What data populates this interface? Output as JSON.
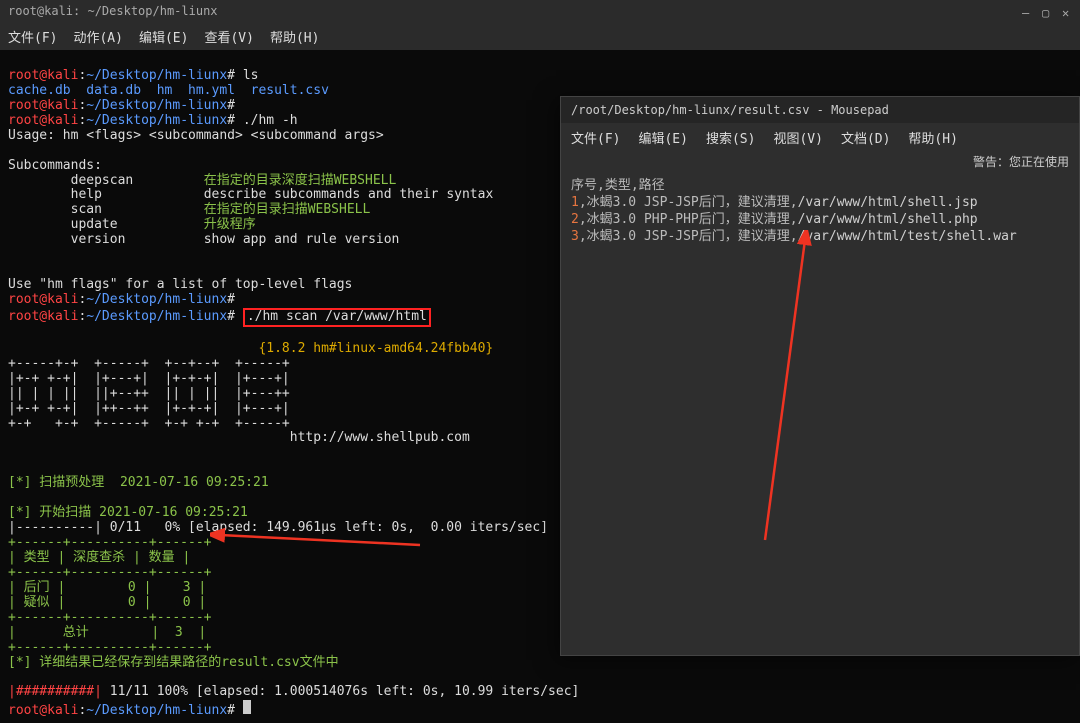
{
  "titlebar": {
    "title": "root@kali: ~/Desktop/hm-liunx"
  },
  "menubar": {
    "items": [
      "文件(F)",
      "动作(A)",
      "编辑(E)",
      "查看(V)",
      "帮助(H)"
    ]
  },
  "prompt": {
    "user": "root@kali",
    "sep": ":",
    "path": "~/Desktop/hm-liunx",
    "sigil": "#"
  },
  "cmd": {
    "ls": "ls",
    "ls_out": "cache.db  data.db  hm  hm.yml  result.csv",
    "hm_h": "./hm -h",
    "usage": "Usage: hm <flags> <subcommand> <subcommand args>",
    "sub_header": "Subcommands:",
    "deepscan": "deepscan",
    "deepscan_desc": "在指定的目录深度扫描WEBSHELL",
    "help": "help",
    "help_desc": "describe subcommands and their syntax",
    "scan": "scan",
    "scan_desc": "在指定的目录扫描WEBSHELL",
    "update": "update",
    "update_desc": "升级程序",
    "version": "version",
    "version_desc": "show app and rule version",
    "flags_hint": "Use \"hm flags\" for a list of top-level flags",
    "scan_cmd": "./hm scan /var/www/html",
    "ver_line": "{1.8.2 hm#linux-amd64.24fbb40}",
    "ascii1": "+-----+-+  +-----+  +--+--+  +-----+",
    "ascii2": "|+-+ +-+|  |+---+|  |+-+-+|  |+---+|",
    "ascii3": "|| | | ||  ||+--++  || | ||  |+---++",
    "ascii4": "|+-+ +-+|  |++--++  |+-+-+|  |+---+|",
    "ascii5": "+-+   +-+  +-----+  +-+ +-+  +-----+",
    "url": "http://www.shellpub.com",
    "pre_scan": "[*] 扫描预处理  2021-07-16 09:25:21",
    "start_scan": "[*] 开始扫描 2021-07-16 09:25:21",
    "bar0": "|----------| 0/11   0% [elapsed: 149.961µs left: 0s,  0.00 iters/sec]",
    "divider": "+------+----------+------+",
    "th": "| 类型 | 深度查杀 | 数量 |",
    "r1": "| 后门 |        0 |    3 |",
    "r2": "| 疑似 |        0 |    0 |",
    "rt": "|      总计        |  3  |",
    "saved": "[*] 详细结果已经保存到结果路径的result.csv文件中",
    "bar_full": "|##########|",
    "bar1": " 11/11 100% [elapsed: 1.000514076s left: 0s, 10.99 iters/sec]"
  },
  "mousepad": {
    "title": "/root/Desktop/hm-liunx/result.csv - Mousepad",
    "menu": [
      "文件(F)",
      "编辑(E)",
      "搜索(S)",
      "视图(V)",
      "文档(D)",
      "帮助(H)"
    ],
    "warn": "警告：您正在使用",
    "header": "序号,类型,路径",
    "rows": [
      {
        "n": "1",
        "t": ",冰蝎3.0 JSP-JSP后门，建议清理,",
        "p": "/var/www/html/shell.jsp"
      },
      {
        "n": "2",
        "t": ",冰蝎3.0 PHP-PHP后门，建议清理,",
        "p": "/var/www/html/shell.php"
      },
      {
        "n": "3",
        "t": ",冰蝎3.0 JSP-JSP后门，建议清理,",
        "p": "/var/www/html/test/shell.war"
      }
    ]
  }
}
